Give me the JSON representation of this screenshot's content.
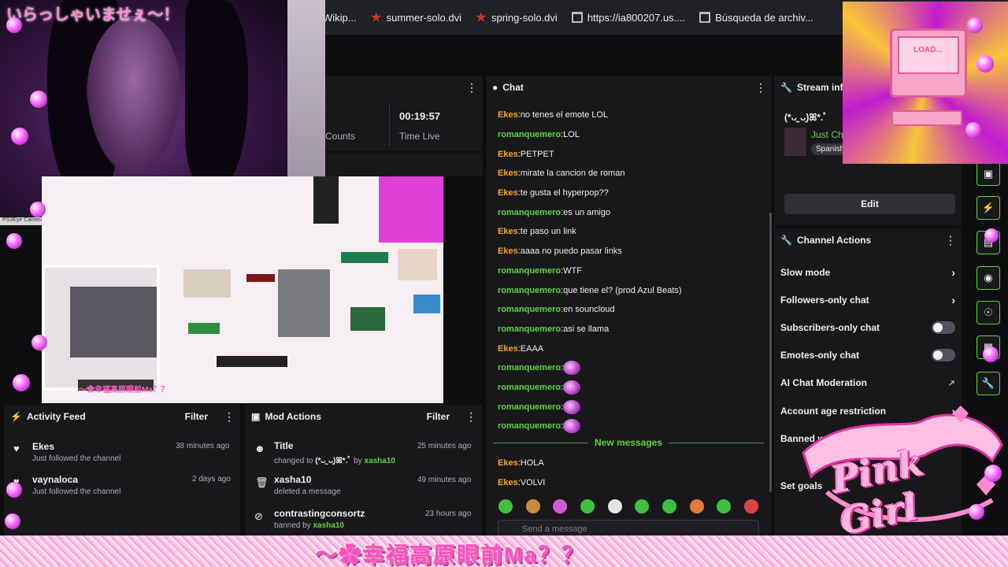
{
  "bookmarks": [
    {
      "label": "Wikip...",
      "icon": "wiki-icon"
    },
    {
      "label": "summer-solo.dvi",
      "icon": "dvi-file-icon"
    },
    {
      "label": "spring-solo.dvi",
      "icon": "dvi-file-icon"
    },
    {
      "label": "https://ia800207.us....",
      "icon": "archive-icon"
    },
    {
      "label": "Búsqueda de archiv...",
      "icon": "archive-icon"
    }
  ],
  "overlay": {
    "webcam_title": "いらっしゃいませぇ～！",
    "webcam_source": "PS3Eye Camera",
    "collage_caption": "～✿幸福高原眼前Ma？？",
    "bottom_banner": "～✿幸福高原眼前Ma？？",
    "logo_text": "Pink Girl",
    "art_screen_text": "LOAD..."
  },
  "stats": {
    "time_value": "00:19:57",
    "time_label": "Time Live",
    "counts_label": "Counts"
  },
  "chat": {
    "title": "Chat",
    "new_messages_label": "New messages",
    "input_placeholder": "Send a message",
    "messages": [
      {
        "user": "Ekes",
        "text": "no tenes el emote LOL",
        "color": "#f5a623"
      },
      {
        "user": "romanquemero",
        "text": "LOL",
        "color": "#5cd33c"
      },
      {
        "user": "Ekes",
        "text": "PETPET",
        "color": "#f5a623"
      },
      {
        "user": "Ekes",
        "text": "mirate la cancion de roman",
        "color": "#f5a623"
      },
      {
        "user": "Ekes",
        "text": "te gusta el hyperpop??",
        "color": "#f5a623"
      },
      {
        "user": "romanquemero",
        "text": "es un amigo",
        "color": "#5cd33c"
      },
      {
        "user": "Ekes",
        "text": "te paso un link",
        "color": "#f5a623"
      },
      {
        "user": "Ekes",
        "text": "aaaa no puedo pasar links",
        "color": "#f5a623"
      },
      {
        "user": "romanquemero",
        "text": "WTF",
        "color": "#5cd33c"
      },
      {
        "user": "romanquemero",
        "text": "que tiene el? (prod Azul Beats)",
        "color": "#5cd33c"
      },
      {
        "user": "romanquemero",
        "text": "en souncloud",
        "color": "#5cd33c"
      },
      {
        "user": "romanquemero",
        "text": "asi se llama",
        "color": "#5cd33c"
      },
      {
        "user": "Ekes",
        "text": "EAAA",
        "color": "#f5a623"
      },
      {
        "user": "romanquemero",
        "text": "",
        "emote": true,
        "color": "#5cd33c"
      },
      {
        "user": "romanquemero",
        "text": "",
        "emote": true,
        "color": "#5cd33c"
      },
      {
        "user": "romanquemero",
        "text": "",
        "emote": true,
        "color": "#5cd33c"
      },
      {
        "user": "romanquemero",
        "text": "",
        "emote": true,
        "color": "#5cd33c"
      }
    ],
    "new_messages": [
      {
        "user": "Ekes",
        "text": "HOLA",
        "color": "#f5a623"
      },
      {
        "user": "Ekes",
        "text": "VOLVI",
        "color": "#f5a623"
      }
    ]
  },
  "stream_info": {
    "header": "Stream info",
    "title": "(*ᴗ͈ˬᴗ͈)ꕤ*.ﾟ",
    "category": "Just Ch",
    "language": "Spanish",
    "edit_label": "Edit"
  },
  "channel_actions": {
    "header": "Channel Actions",
    "items": [
      {
        "label": "Slow mode",
        "control": "chevron"
      },
      {
        "label": "Followers-only chat",
        "control": "chevron"
      },
      {
        "label": "Subscribers-only chat",
        "control": "toggle"
      },
      {
        "label": "Emotes-only chat",
        "control": "toggle"
      },
      {
        "label": "AI Chat Moderation",
        "control": "external"
      },
      {
        "label": "Account age restriction",
        "control": "chevron"
      },
      {
        "label": "Banned words",
        "control": "none"
      },
      {
        "label": "Set goals",
        "control": "none"
      }
    ]
  },
  "activity_feed": {
    "header": "Activity Feed",
    "filter_label": "Filter",
    "items": [
      {
        "name": "Ekes",
        "sub": "Just followed the channel",
        "time": "38 minutes ago"
      },
      {
        "name": "vaynaloca",
        "sub": "Just followed the channel",
        "time": "2 days ago"
      }
    ]
  },
  "mod_actions": {
    "header": "Mod Actions",
    "filter_label": "Filter",
    "items": [
      {
        "name": "Title",
        "sub_prefix": "changed to ",
        "sub_value": "(*ᴗ͈ˬᴗ͈)ꕤ*.ﾟ",
        "by": " by ",
        "mod": "xasha10",
        "time": "25 minutes ago"
      },
      {
        "name": "xasha10",
        "sub_prefix": "deleted a message",
        "sub_value": "",
        "by": "",
        "mod": "",
        "time": "49 minutes ago"
      },
      {
        "name": "contrastingconsortz",
        "sub_prefix": "banned by ",
        "sub_value": "",
        "by": "",
        "mod": "xasha10",
        "time": "23 hours ago"
      }
    ]
  },
  "colors": {
    "accent_green": "#5cd33c",
    "user_orange": "#f5a623",
    "panel_bg": "#18181b"
  }
}
